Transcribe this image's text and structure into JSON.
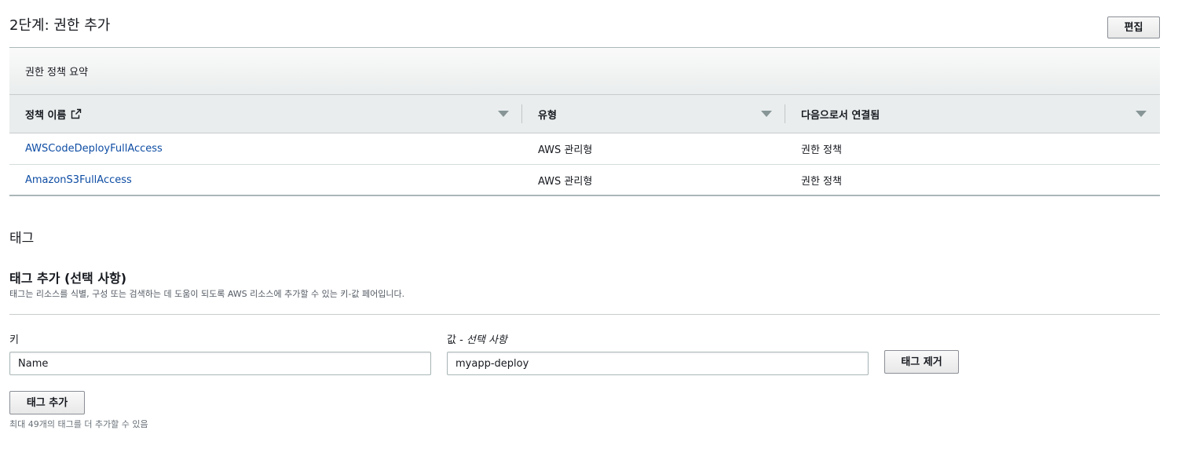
{
  "step": {
    "title": "2단계: 권한 추가",
    "edit_label": "편집"
  },
  "summary": {
    "heading": "권한 정책 요약",
    "columns": [
      "정책 이름",
      "유형",
      "다음으로서 연결됨"
    ],
    "rows": [
      {
        "name": "AWSCodeDeployFullAccess",
        "type": "AWS 관리형",
        "attached": "권한 정책"
      },
      {
        "name": "AmazonS3FullAccess",
        "type": "AWS 관리형",
        "attached": "권한 정책"
      }
    ]
  },
  "tags": {
    "section_title": "태그",
    "add_title": "태그 추가 (선택 사항)",
    "description": "태그는 리소스를 식별, 구성 또는 검색하는 데 도움이 되도록 AWS 리소스에 추가할 수 있는 키-값 페어입니다.",
    "key_label": "키",
    "value_label": "값 - ",
    "value_optional": "선택 사항",
    "key_value": "Name",
    "value_value": "myapp-deploy",
    "remove_label": "태그 제거",
    "add_label": "태그 추가",
    "hint": "최대 49개의 태그를 더 추가할 수 있음"
  },
  "icons": {
    "external_link": "external-link-icon",
    "sort": "caret-down-icon"
  },
  "colors": {
    "link": "#0e4da4",
    "header_bg": "#eaeded",
    "text": "#16191f"
  }
}
